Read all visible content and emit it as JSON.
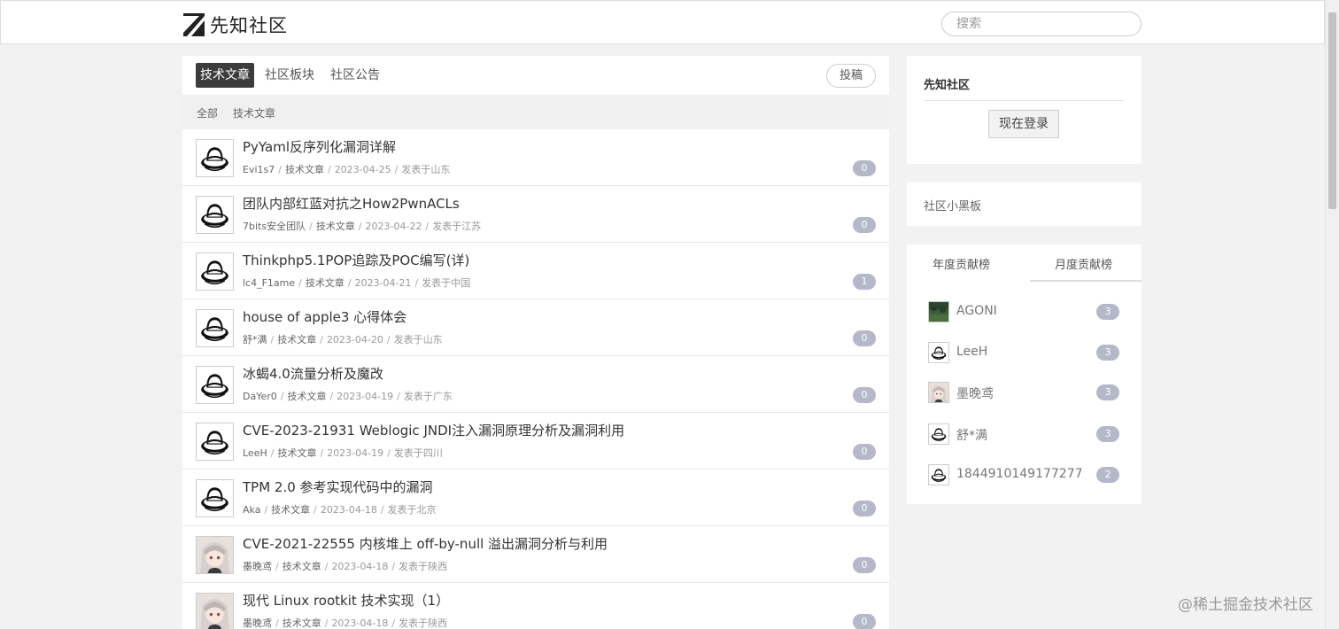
{
  "header": {
    "logo_text": "先知社区",
    "search_placeholder": "搜索"
  },
  "tabs": {
    "active": "技术文章",
    "community": "社区板块",
    "notice": "社区公告",
    "submit": "投稿"
  },
  "breadcrumb": {
    "all": "全部",
    "current": "技术文章"
  },
  "articles": [
    {
      "title": "PyYaml反序列化漏洞详解",
      "author": "Evi1s7",
      "category": "技术文章",
      "date": "2023-04-25",
      "location": "发表于山东",
      "count": "0",
      "avatar": "hat-avatar"
    },
    {
      "title": "团队内部红蓝对抗之How2PwnACLs",
      "author": "7bits安全团队",
      "category": "技术文章",
      "date": "2023-04-22",
      "location": "发表于江苏",
      "count": "0",
      "avatar": "hat-avatar"
    },
    {
      "title": "Thinkphp5.1POP追踪及POC编写(详)",
      "author": "lc4_F1ame",
      "category": "技术文章",
      "date": "2023-04-21",
      "location": "发表于中国",
      "count": "1",
      "avatar": "hat-avatar"
    },
    {
      "title": "house of apple3 心得体会",
      "author": "舒*满",
      "category": "技术文章",
      "date": "2023-04-20",
      "location": "发表于山东",
      "count": "0",
      "avatar": "hat-avatar"
    },
    {
      "title": "冰蝎4.0流量分析及魔改",
      "author": "DaYer0",
      "category": "技术文章",
      "date": "2023-04-19",
      "location": "发表于广东",
      "count": "0",
      "avatar": "hat-avatar"
    },
    {
      "title": "CVE-2023-21931 Weblogic JNDI注入漏洞原理分析及漏洞利用",
      "author": "LeeH",
      "category": "技术文章",
      "date": "2023-04-19",
      "location": "发表于四川",
      "count": "0",
      "avatar": "hat-avatar"
    },
    {
      "title": "TPM 2.0 参考实现代码中的漏洞",
      "author": "Aka",
      "category": "技术文章",
      "date": "2023-04-18",
      "location": "发表于北京",
      "count": "0",
      "avatar": "hat-avatar"
    },
    {
      "title": "CVE-2021-22555 内核堆上 off-by-null 溢出漏洞分析与利用",
      "author": "墨晚鸢",
      "category": "技术文章",
      "date": "2023-04-18",
      "location": "发表于陕西",
      "count": "0",
      "avatar": "anime-avatar"
    },
    {
      "title": "现代 Linux rootkit 技术实现（1）",
      "author": "墨晚鸢",
      "category": "技术文章",
      "date": "2023-04-18",
      "location": "发表于陕西",
      "count": "0",
      "avatar": "anime-avatar"
    }
  ],
  "sidebar": {
    "login_title": "先知社区",
    "login_button": "现在登录",
    "board_title": "社区小黑板",
    "rank_tab_year": "年度贡献榜",
    "rank_tab_month": "月度贡献榜",
    "ranking": [
      {
        "name": "AGONI",
        "count": "3",
        "avatar": "landscape-avatar"
      },
      {
        "name": "LeeH",
        "count": "3",
        "avatar": "hat-avatar"
      },
      {
        "name": "墨晚鸢",
        "count": "3",
        "avatar": "anime-avatar"
      },
      {
        "name": "舒*满",
        "count": "3",
        "avatar": "hat-avatar"
      },
      {
        "name": "1844910149177277",
        "count": "2",
        "avatar": "hat-avatar"
      }
    ]
  },
  "watermark": "@稀土掘金技术社区",
  "colors": {
    "background": "#f2f2f2",
    "active_tab": "#3c3c3c",
    "badge": "#b4b8c8"
  }
}
